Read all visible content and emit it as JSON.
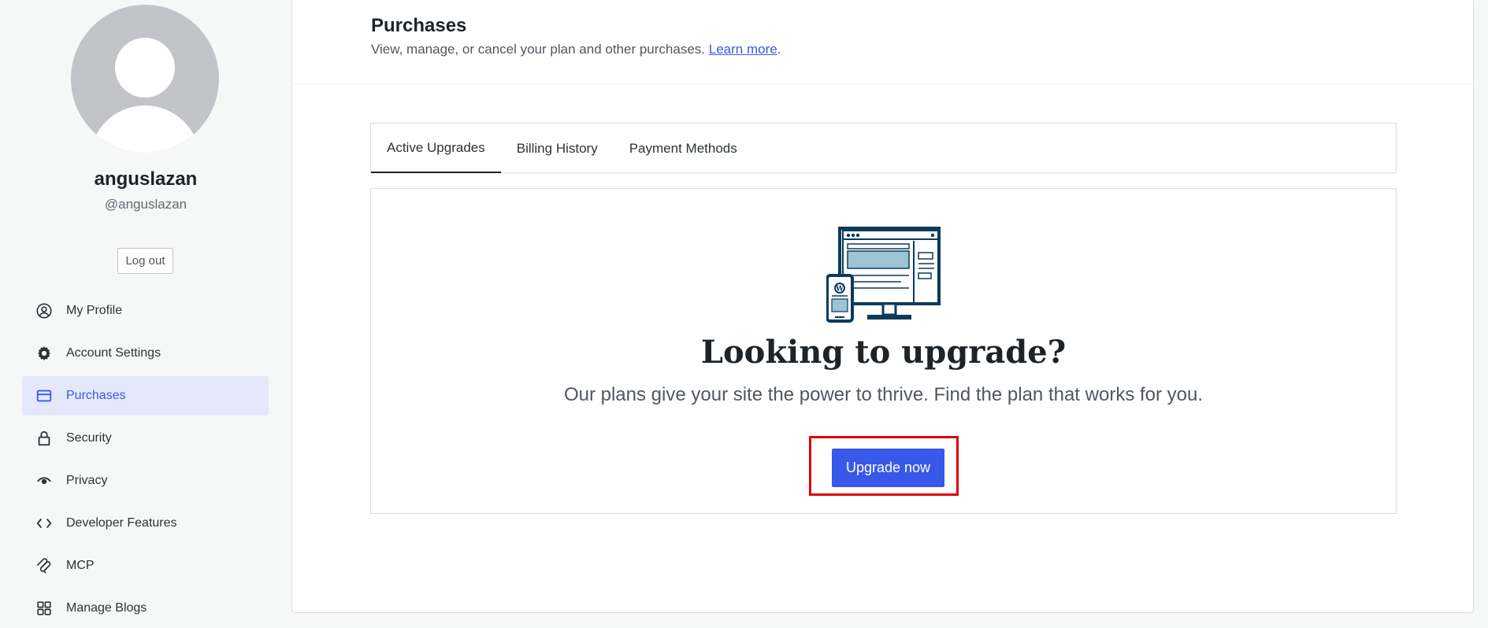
{
  "profile": {
    "display_name": "anguslazan",
    "username": "@anguslazan",
    "logout_label": "Log out"
  },
  "sidebar": {
    "items": [
      {
        "label": "My Profile",
        "icon": "user-circle-icon",
        "active": false
      },
      {
        "label": "Account Settings",
        "icon": "gear-icon",
        "active": false
      },
      {
        "label": "Purchases",
        "icon": "credit-card-icon",
        "active": true
      },
      {
        "label": "Security",
        "icon": "lock-icon",
        "active": false
      },
      {
        "label": "Privacy",
        "icon": "eye-icon",
        "active": false
      },
      {
        "label": "Developer Features",
        "icon": "code-icon",
        "active": false
      },
      {
        "label": "MCP",
        "icon": "mcp-icon",
        "active": false
      },
      {
        "label": "Manage Blogs",
        "icon": "grid-icon",
        "active": false
      }
    ]
  },
  "header": {
    "title": "Purchases",
    "subtitle": "View, manage, or cancel your plan and other purchases.",
    "learn_more": "Learn more",
    "period": "."
  },
  "tabs": [
    {
      "label": "Active Upgrades",
      "active": true
    },
    {
      "label": "Billing History",
      "active": false
    },
    {
      "label": "Payment Methods",
      "active": false
    }
  ],
  "empty_state": {
    "title": "Looking to upgrade?",
    "subtitle": "Our plans give your site the power to thrive. Find the plan that works for you.",
    "button_label": "Upgrade now",
    "illustration_icon": "devices-illustration-icon"
  },
  "colors": {
    "accent": "#3858e9",
    "active_nav_bg": "#e5e8fb",
    "highlight": "#e00000",
    "illustration_dark": "#0b3a5c",
    "illustration_light": "#9dc3d6"
  }
}
